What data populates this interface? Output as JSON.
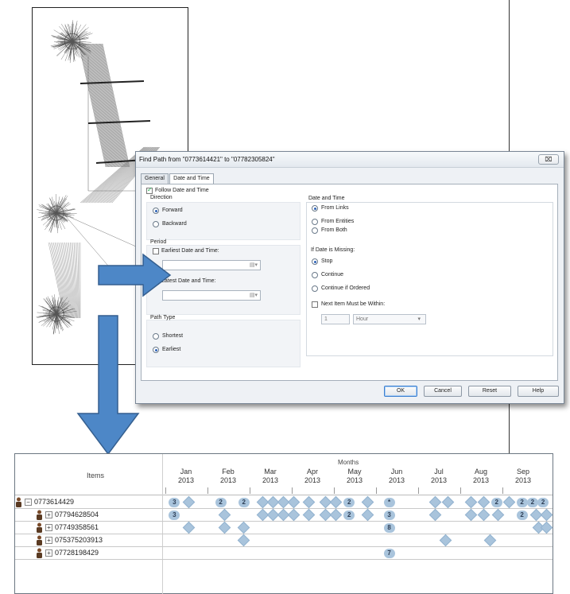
{
  "dialog": {
    "title": "Find Path from \"0773614421\" to \"07782305824\"",
    "close_label": "⌧",
    "tabs": [
      {
        "label": "General",
        "active": false
      },
      {
        "label": "Date and Time",
        "active": true
      }
    ],
    "follow_date_time": {
      "label": "Follow Date and Time",
      "checked": true
    },
    "direction": {
      "title": "Direction",
      "options": [
        {
          "label": "Forward",
          "selected": true
        },
        {
          "label": "Backward",
          "selected": false
        }
      ]
    },
    "period": {
      "title": "Period",
      "earliest": {
        "label": "Earliest Date and Time:",
        "checked": false
      },
      "latest": {
        "label": "Latest Date and Time:",
        "checked": false
      }
    },
    "path_type": {
      "title": "Path Type",
      "options": [
        {
          "label": "Shortest",
          "selected": false
        },
        {
          "label": "Earliest",
          "selected": true
        }
      ]
    },
    "date_and_time": {
      "title": "Date and Time",
      "options": [
        {
          "label": "From Links",
          "selected": true
        },
        {
          "label": "From Entities",
          "selected": false
        },
        {
          "label": "From Both",
          "selected": false
        }
      ]
    },
    "if_missing": {
      "title": "If Date is Missing:",
      "options": [
        {
          "label": "Stop",
          "selected": true
        },
        {
          "label": "Continue",
          "selected": false
        },
        {
          "label": "Continue if Ordered",
          "selected": false
        }
      ]
    },
    "next_item": {
      "label": "Next Item Must be Within:",
      "checked": false,
      "value": "1",
      "unit": "Hour"
    },
    "buttons": {
      "ok": "OK",
      "cancel": "Cancel",
      "reset": "Reset",
      "help": "Help"
    }
  },
  "timeline": {
    "items_header": "Items",
    "months_header": "Months",
    "months": [
      {
        "name": "Jan",
        "year": "2013"
      },
      {
        "name": "Feb",
        "year": "2013"
      },
      {
        "name": "Mar",
        "year": "2013"
      },
      {
        "name": "Apr",
        "year": "2013"
      },
      {
        "name": "May",
        "year": "2013"
      },
      {
        "name": "Jun",
        "year": "2013"
      },
      {
        "name": "Jul",
        "year": "2013"
      },
      {
        "name": "Aug",
        "year": "2013"
      },
      {
        "name": "Sep",
        "year": "2013"
      }
    ],
    "rows": [
      {
        "label": "0773614429",
        "expander": "−"
      },
      {
        "label": "07794628504",
        "expander": "+"
      },
      {
        "label": "07749358561",
        "expander": "+"
      },
      {
        "label": "075375203913",
        "expander": "+"
      },
      {
        "label": "07728198429",
        "expander": "+"
      }
    ],
    "markers": [
      {
        "row": 0,
        "month": 0.1,
        "count": "3"
      },
      {
        "row": 0,
        "month": 0.45
      },
      {
        "row": 0,
        "month": 1.2,
        "count": "2"
      },
      {
        "row": 0,
        "month": 1.75,
        "count": "2"
      },
      {
        "row": 0,
        "month": 2.2
      },
      {
        "row": 0,
        "month": 2.45
      },
      {
        "row": 0,
        "month": 2.7
      },
      {
        "row": 0,
        "month": 2.95
      },
      {
        "row": 0,
        "month": 3.3
      },
      {
        "row": 0,
        "month": 3.7
      },
      {
        "row": 0,
        "month": 3.95
      },
      {
        "row": 0,
        "month": 4.25,
        "count": "2"
      },
      {
        "row": 0,
        "month": 4.7
      },
      {
        "row": 0,
        "month": 5.2,
        "count": "*"
      },
      {
        "row": 0,
        "month": 6.3
      },
      {
        "row": 0,
        "month": 6.6
      },
      {
        "row": 0,
        "month": 7.15
      },
      {
        "row": 0,
        "month": 7.45
      },
      {
        "row": 0,
        "month": 7.75,
        "count": "2"
      },
      {
        "row": 0,
        "month": 8.05
      },
      {
        "row": 0,
        "month": 8.35,
        "count": "2"
      },
      {
        "row": 0,
        "month": 8.6,
        "count": "2"
      },
      {
        "row": 0,
        "month": 8.85,
        "count": "2"
      },
      {
        "row": 1,
        "month": 0.1,
        "count": "3"
      },
      {
        "row": 1,
        "month": 1.3
      },
      {
        "row": 1,
        "month": 2.2
      },
      {
        "row": 1,
        "month": 2.45
      },
      {
        "row": 1,
        "month": 2.7
      },
      {
        "row": 1,
        "month": 2.95
      },
      {
        "row": 1,
        "month": 3.3
      },
      {
        "row": 1,
        "month": 3.7
      },
      {
        "row": 1,
        "month": 3.95
      },
      {
        "row": 1,
        "month": 4.25,
        "count": "2"
      },
      {
        "row": 1,
        "month": 4.7
      },
      {
        "row": 1,
        "month": 5.2,
        "count": "3"
      },
      {
        "row": 1,
        "month": 6.3
      },
      {
        "row": 1,
        "month": 7.15
      },
      {
        "row": 1,
        "month": 7.45
      },
      {
        "row": 1,
        "month": 7.8
      },
      {
        "row": 1,
        "month": 8.35,
        "count": "2"
      },
      {
        "row": 1,
        "month": 8.7
      },
      {
        "row": 1,
        "month": 8.95
      },
      {
        "row": 2,
        "month": 0.45
      },
      {
        "row": 2,
        "month": 1.3
      },
      {
        "row": 2,
        "month": 1.75
      },
      {
        "row": 2,
        "month": 5.2,
        "count": "8"
      },
      {
        "row": 2,
        "month": 8.75
      },
      {
        "row": 2,
        "month": 8.95
      },
      {
        "row": 3,
        "month": 1.75
      },
      {
        "row": 3,
        "month": 6.55
      },
      {
        "row": 3,
        "month": 7.6
      },
      {
        "row": 4,
        "month": 5.2,
        "count": "7"
      }
    ]
  }
}
